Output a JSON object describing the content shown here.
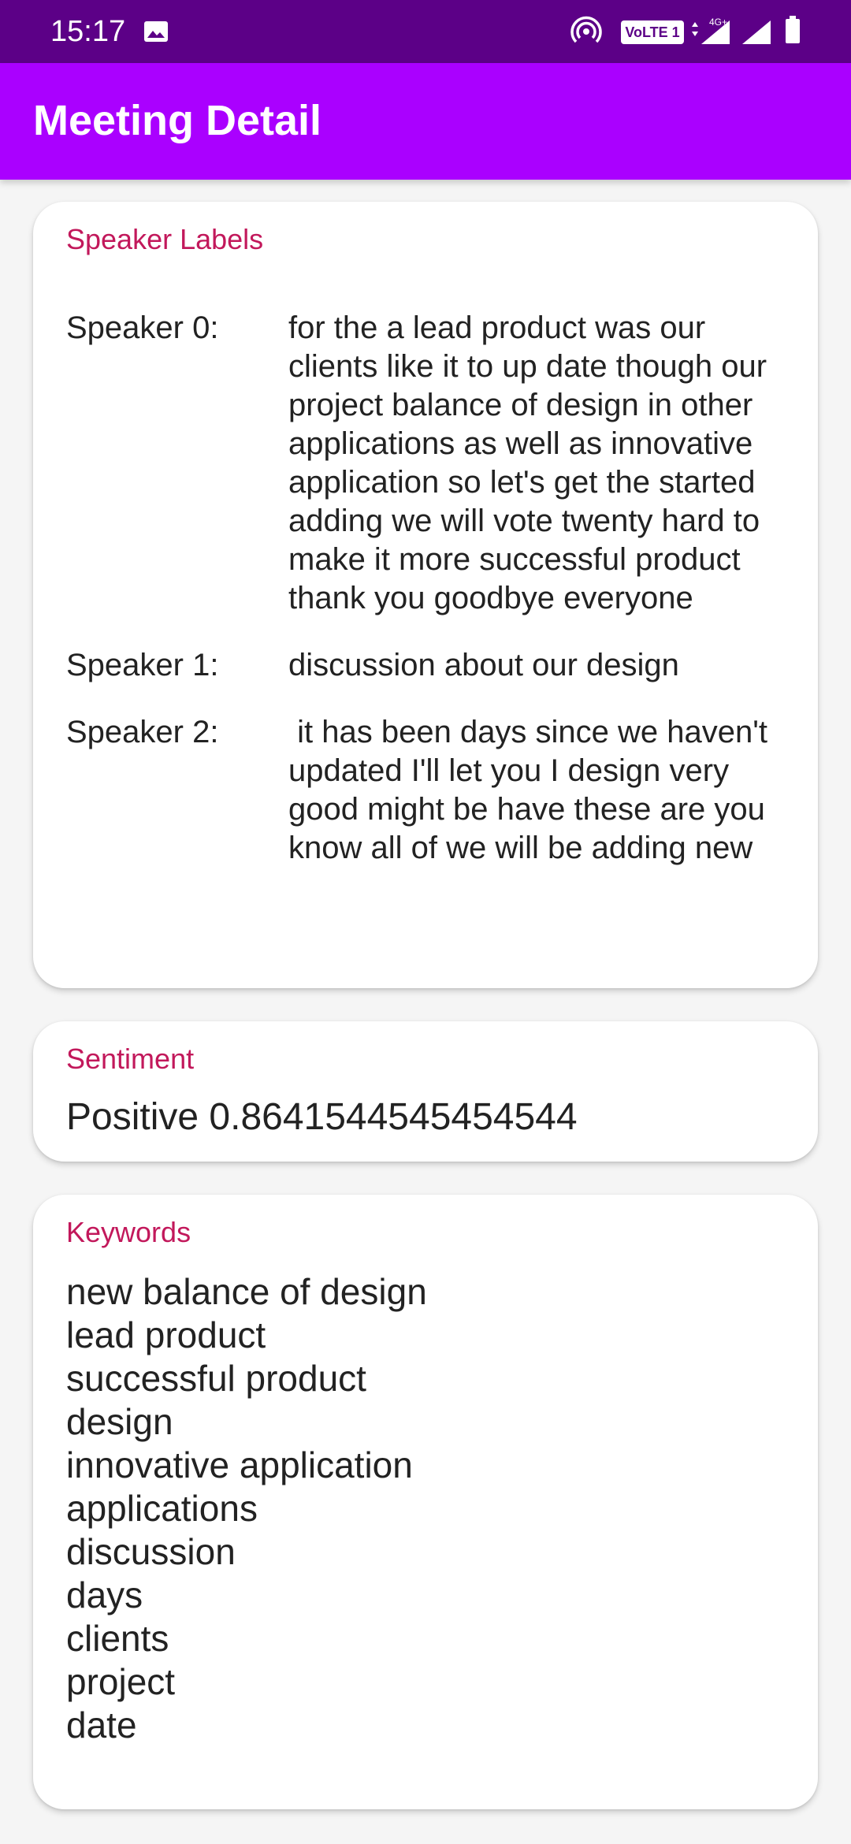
{
  "status_bar": {
    "time": "15:17",
    "volte_label": "VoLTE 1",
    "net_label": "4G+",
    "icons": [
      "gallery-icon",
      "hotspot-icon",
      "volte-icon",
      "network-4g-icon",
      "signal-icon",
      "signal-icon",
      "battery-icon"
    ]
  },
  "app_bar": {
    "title": "Meeting Detail"
  },
  "speakers_card": {
    "label": "Speaker Labels",
    "speakers": [
      {
        "name": "Speaker 0:",
        "text": "for the a lead product was our clients like it to up date though our project balance of design in other applications as well as innovative application so let's get the started adding we will vote twenty hard to make it more successful product thank you goodbye everyone"
      },
      {
        "name": "Speaker 1:",
        "text": "discussion about our design"
      },
      {
        "name": "Speaker 2:",
        "text": " it has been days since we haven't updated I'll let you I design very good might be have these are you know all of we will be adding new"
      }
    ]
  },
  "sentiment_card": {
    "label": "Sentiment",
    "value": "Positive 0.8641544545454544"
  },
  "keywords_card": {
    "label": "Keywords",
    "keywords": [
      "new balance of design",
      "lead product",
      "successful product",
      "design",
      "innovative application",
      "applications",
      "discussion",
      "days",
      "clients",
      "project",
      "date"
    ]
  },
  "colors": {
    "status_bar": "#5c0087",
    "app_bar": "#aa00ff",
    "card_label": "#c2185b",
    "text": "#222222",
    "background": "#f5f5f5"
  }
}
